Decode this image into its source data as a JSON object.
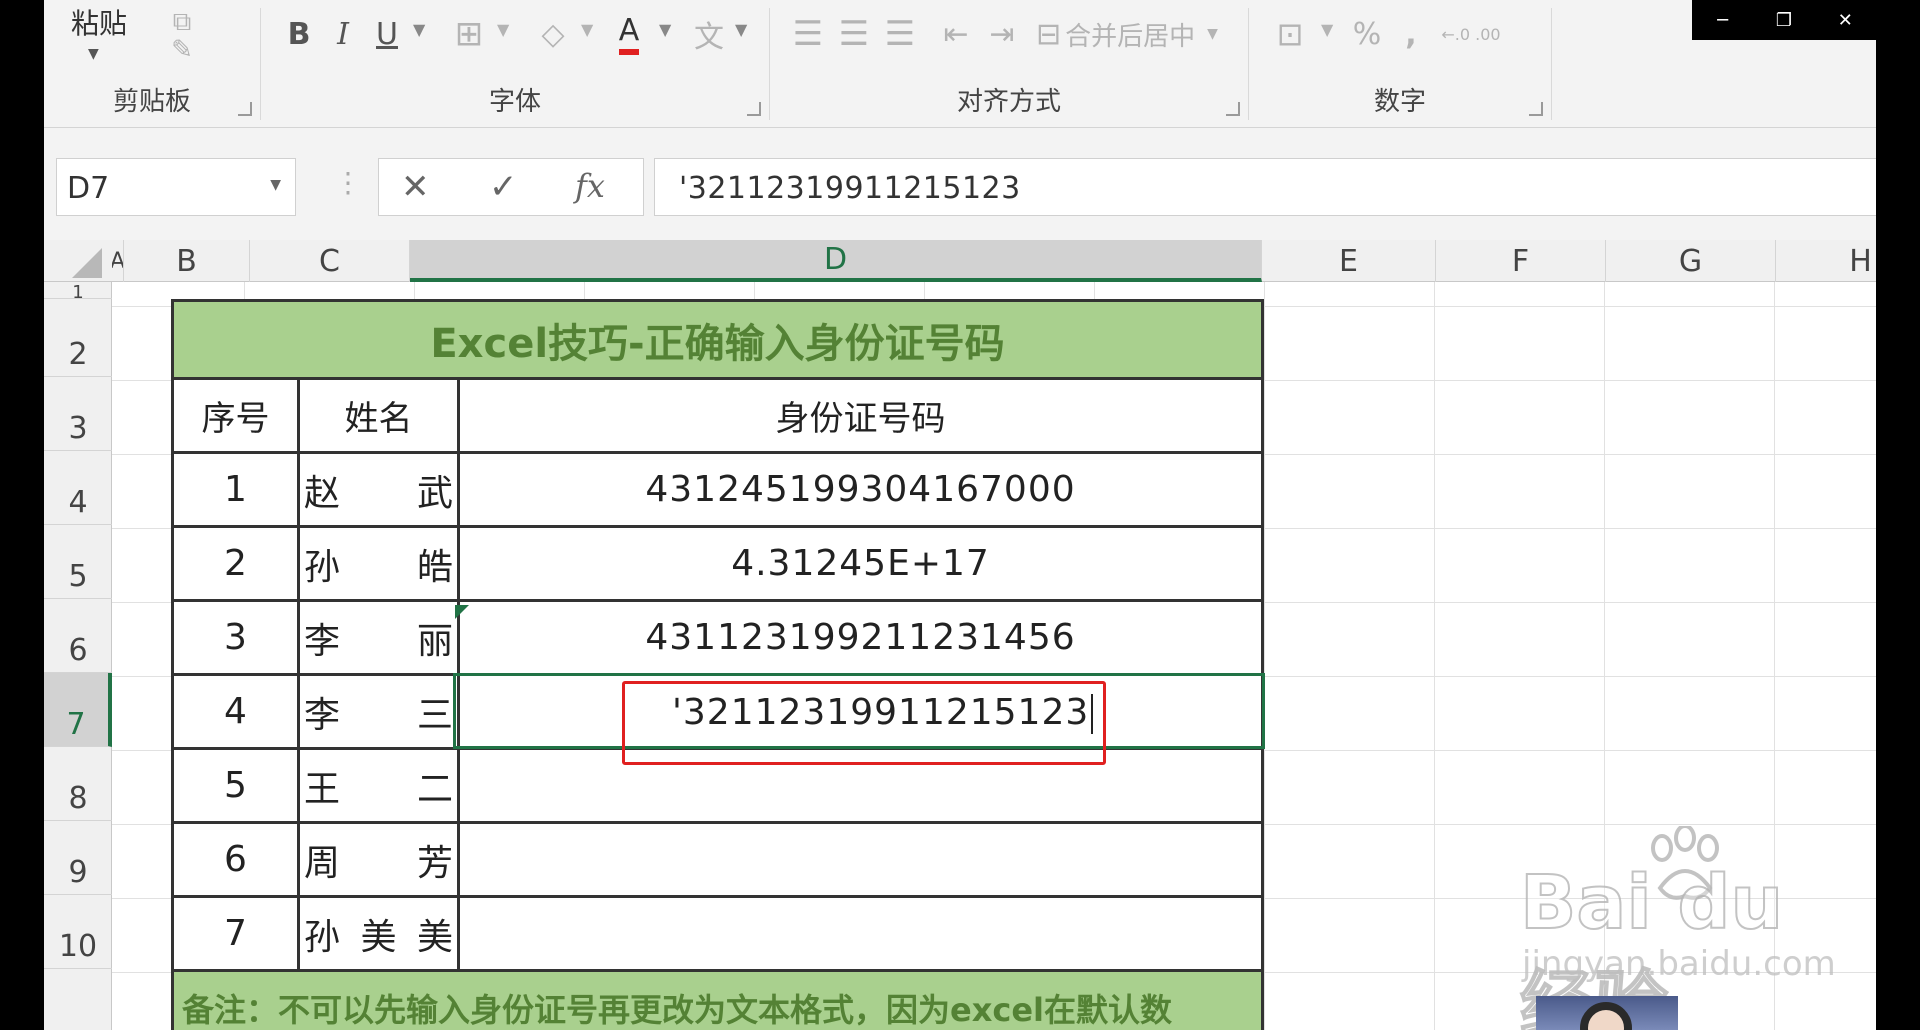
{
  "ribbon": {
    "clipboard": {
      "label": "剪贴板",
      "paste": "粘贴"
    },
    "font": {
      "label": "字体",
      "bold": "B",
      "italic": "I",
      "underline": "U",
      "font_color": "A",
      "phonetic": "文"
    },
    "alignment": {
      "label": "对齐方式",
      "merge": "合并后居中"
    },
    "number": {
      "label": "数字",
      "percent": "%",
      "comma": ",",
      "decimals": "←.0 .00"
    }
  },
  "window_controls": {
    "minimize": "─",
    "restore": "❐",
    "close": "✕"
  },
  "formula_bar": {
    "name_box": "D7",
    "cancel": "✕",
    "enter": "✓",
    "fx": "fx",
    "value": "'32112319911215123"
  },
  "columns": [
    "A",
    "B",
    "C",
    "D",
    "E",
    "F",
    "G",
    "H"
  ],
  "rows": [
    "1",
    "2",
    "3",
    "4",
    "5",
    "6",
    "7",
    "8",
    "9",
    "10"
  ],
  "sheet": {
    "title": "Excel技巧-正确输入身份证号码",
    "headers": [
      "序号",
      "姓名",
      "身份证号码"
    ],
    "records": [
      {
        "no": "1",
        "name": [
          "赵",
          "武"
        ],
        "id": "431245199304167000"
      },
      {
        "no": "2",
        "name": [
          "孙",
          "皓"
        ],
        "id": "4.31245E+17"
      },
      {
        "no": "3",
        "name": [
          "李",
          "丽"
        ],
        "id": "431123199211231456"
      },
      {
        "no": "4",
        "name": [
          "李",
          "三"
        ],
        "id": ""
      },
      {
        "no": "5",
        "name": [
          "王",
          "二"
        ],
        "id": ""
      },
      {
        "no": "6",
        "name": [
          "周",
          "芳"
        ],
        "id": ""
      },
      {
        "no": "7",
        "name": [
          "孙",
          "美",
          "美"
        ],
        "id": ""
      }
    ],
    "editing_value": "'32112319911215123",
    "note": "备注：不可以先输入身份证号再更改为文本格式，因为excel在默认数"
  },
  "watermark": {
    "brand": "Bai du 经验",
    "url": "jingyan.baidu.com"
  },
  "colors": {
    "accent": "#217346",
    "title_bg": "#a9d08e",
    "title_text": "#548235",
    "highlight": "#e02020"
  }
}
